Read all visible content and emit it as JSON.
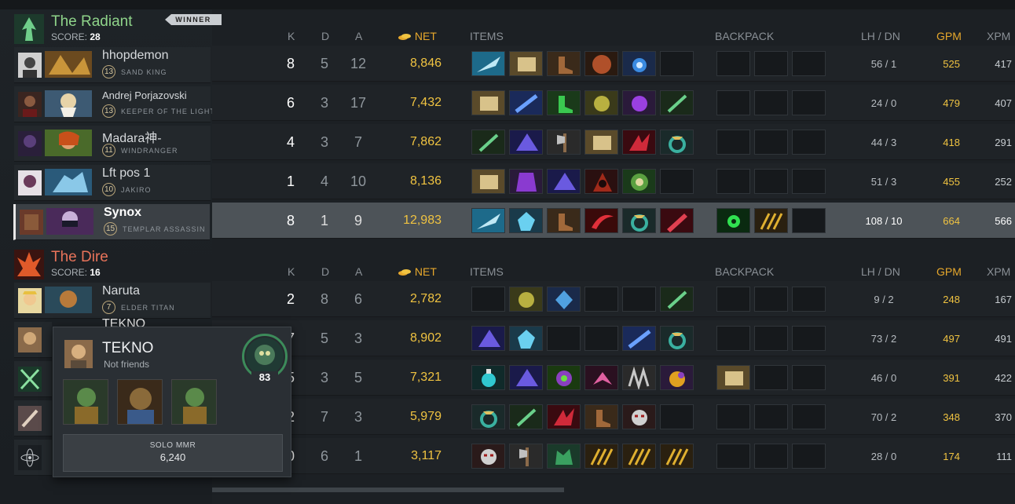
{
  "radiant": {
    "name": "The Radiant",
    "score_label": "SCORE:",
    "score": "28",
    "badge": "WINNER",
    "players": [
      {
        "name": "hhopdemon",
        "level": "13",
        "hero": "SAND KING"
      },
      {
        "name": "Andrej Porjazovski",
        "level": "13",
        "hero": "KEEPER OF THE LIGHT"
      },
      {
        "name": "Madara神-",
        "level": "11",
        "hero": "WINDRANGER"
      },
      {
        "name": "Lft pos 1",
        "level": "10",
        "hero": "JAKIRO"
      },
      {
        "name": "Synox",
        "level": "15",
        "hero": "TEMPLAR ASSASSIN"
      }
    ]
  },
  "dire": {
    "name": "The Dire",
    "score_label": "SCORE:",
    "score": "16",
    "players": [
      {
        "name": "Naruta",
        "level": "7",
        "hero": "ELDER TITAN"
      },
      {
        "name": "TEKNO"
      }
    ]
  },
  "headers": {
    "k": "K",
    "d": "D",
    "a": "A",
    "net": "NET",
    "items": "ITEMS",
    "backpack": "BACKPACK",
    "lh": "LH",
    "slash": "/",
    "dn": "DN",
    "gpm": "GPM",
    "xpm": "XPM"
  },
  "radiant_stats": [
    {
      "k": "8",
      "d": "5",
      "a": "12",
      "net": "8,846",
      "lh": "56",
      "dn": "1",
      "gpm": "525",
      "xpm": "417"
    },
    {
      "k": "6",
      "d": "3",
      "a": "17",
      "net": "7,432",
      "lh": "24",
      "dn": "0",
      "gpm": "479",
      "xpm": "407"
    },
    {
      "k": "4",
      "d": "3",
      "a": "7",
      "net": "7,862",
      "lh": "44",
      "dn": "3",
      "gpm": "418",
      "xpm": "291"
    },
    {
      "k": "1",
      "d": "4",
      "a": "10",
      "net": "8,136",
      "lh": "51",
      "dn": "3",
      "gpm": "455",
      "xpm": "252"
    },
    {
      "k": "8",
      "d": "1",
      "a": "9",
      "net": "12,983",
      "lh": "108",
      "dn": "10",
      "gpm": "664",
      "xpm": "566"
    }
  ],
  "dire_stats": [
    {
      "k": "2",
      "d": "8",
      "a": "6",
      "net": "2,782",
      "lh": "9",
      "dn": "2",
      "gpm": "248",
      "xpm": "167"
    },
    {
      "k": "7",
      "d": "5",
      "a": "3",
      "net": "8,902",
      "lh": "73",
      "dn": "2",
      "gpm": "497",
      "xpm": "491"
    },
    {
      "k": "5",
      "d": "3",
      "a": "5",
      "net": "7,321",
      "lh": "46",
      "dn": "0",
      "gpm": "391",
      "xpm": "422"
    },
    {
      "k": "2",
      "d": "7",
      "a": "3",
      "net": "5,979",
      "lh": "70",
      "dn": "2",
      "gpm": "348",
      "xpm": "370"
    },
    {
      "k": "0",
      "d": "6",
      "a": "1",
      "net": "3,117",
      "lh": "28",
      "dn": "0",
      "gpm": "174",
      "xpm": "111"
    }
  ],
  "tooltip": {
    "name": "TEKNO",
    "status": "Not friends",
    "level": "83",
    "mmr_label": "SOLO MMR",
    "mmr_value": "6,240"
  },
  "colors": {
    "radiant": "#8fd48a",
    "dire": "#e8735a",
    "gold": "#f0c341"
  }
}
